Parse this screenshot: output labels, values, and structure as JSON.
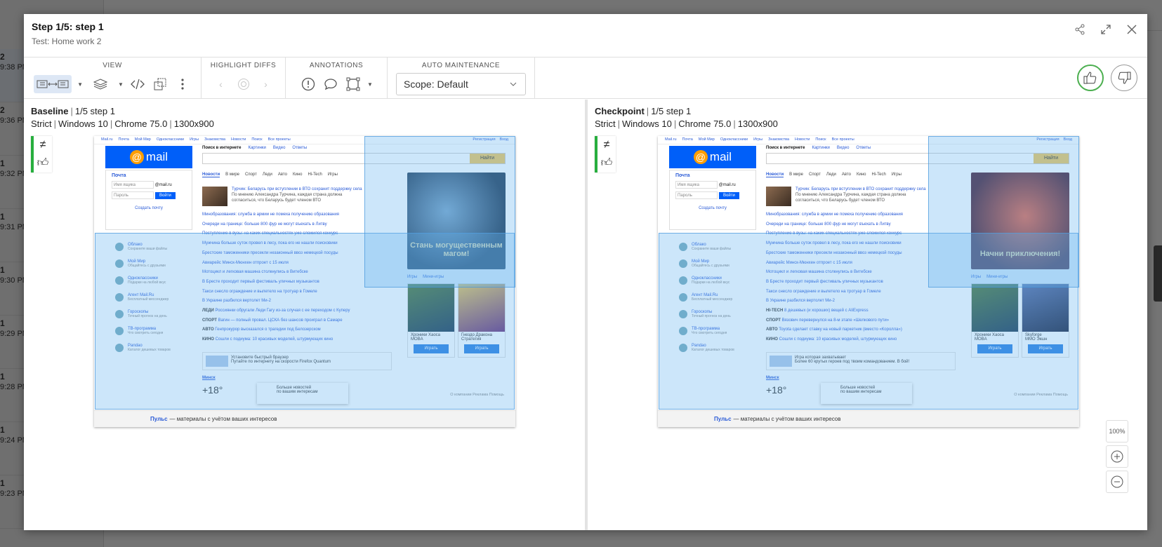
{
  "background": {
    "rows": [
      {
        "num": "2",
        "time": "9:38 PM",
        "selected": true
      },
      {
        "num": "2",
        "time": "9:36 PM"
      },
      {
        "num": "1",
        "time": "9:32 PM"
      },
      {
        "num": "1",
        "time": "9:31 PM"
      },
      {
        "num": "1",
        "time": "9:30 PM"
      },
      {
        "num": "1",
        "time": "9:29 PM"
      },
      {
        "num": "1",
        "time": "9:28 PM"
      },
      {
        "num": "1",
        "time": "9:24 PM"
      },
      {
        "num": "1",
        "time": "9:23 PM"
      }
    ]
  },
  "modal": {
    "title": "Step 1/5: step 1",
    "subtitle": "Test: Home work 2",
    "actions": [
      "share-icon",
      "expand-icon",
      "close-icon"
    ]
  },
  "toolbar": {
    "view_label": "VIEW",
    "highlight_label": "HIGHLIGHT DIFFS",
    "annotations_label": "ANNOTATIONS",
    "auto_label": "AUTO MAINTENANCE",
    "scope_value": "Scope: Default",
    "accent_color": "#4caf50"
  },
  "baseline": {
    "label": "Baseline",
    "step": "1/5 step 1",
    "match": "Strict",
    "os": "Windows 10",
    "browser": "Chrome 75.0",
    "size": "1300x900"
  },
  "checkpoint": {
    "label": "Checkpoint",
    "step": "1/5 step 1",
    "match": "Strict",
    "os": "Windows 10",
    "browser": "Chrome 75.0",
    "size": "1300x900"
  },
  "shot": {
    "topnav": [
      "Mail.ru",
      "Почта",
      "Мой Мир",
      "Одноклассники",
      "Игры",
      "Знакомства",
      "Новости",
      "Поиск",
      "Все проекты"
    ],
    "topnav_right": [
      "Регистрация",
      "Вход"
    ],
    "logo": "mail",
    "login_title": "Почта",
    "login_user": "Имя ящика",
    "login_domain": "@mail.ru",
    "login_pass": "Пароль",
    "login_button": "Войти",
    "login_create": "Создать почту",
    "search_tabs": [
      "Поиск в интернете",
      "Картинки",
      "Видео",
      "Ответы"
    ],
    "search_button": "Найти",
    "news_tabs": [
      "Новости",
      "В мире",
      "Спорт",
      "Леди",
      "Авто",
      "Кино",
      "Hi-Tech",
      "Игры"
    ],
    "news_first": "Турчин: Беларусь при вступлении в ВТО сохранит поддержку села",
    "news_first_desc": "По мнению Александра Турчина, каждая страна должна согласиться, что Беларусь будет членом ВТО",
    "news": [
      "Минобразования: служба в армии не помеха получению образования",
      "Очереди на границе: больше 800 фур не могут въехать в Литву",
      "Поступление в вузы: на каких специальностях уже сложился конкурс",
      "Мужчина больше суток провел в лесу, пока его не нашли поисковики",
      "Брестские таможенники пресекли незаконный ввоз немецкой посуды",
      "Авиарейс Минск-Мюнхен отпроет с 15 июля",
      "Мотоцикл и легковая машина столкнулись в Витебске",
      "В Бресте проходит первый фестиваль уличных музыкантов",
      "Такси снесло ограждение и вылетело на тротуар в Гомеле",
      "В Украине разбился вертолет Ми-2"
    ],
    "news_extra_base": [
      {
        "p": "ЛЕДИ",
        "t": "Россиянки обругали Леди Гагу из-за случая с ее переходом с Куперу"
      },
      {
        "p": "СПОРТ",
        "t": "Вагин — полный провал. ЦСКА без шансов проиграл в Самаре"
      },
      {
        "p": "АВТО",
        "t": "Генпрокурор высказался о трагедии под Белозерском"
      },
      {
        "p": "КИНО",
        "t": "Сошли с подиума: 10 красивых моделей, штурмующих кино"
      }
    ],
    "news_extra_check": [
      {
        "p": "HI-TECH",
        "t": "8 дешевых (и хороших) вещей с AliExpress"
      },
      {
        "p": "СПОРТ",
        "t": "Вязович перевернулся на 8-м этапе «Шелкового пути»"
      },
      {
        "p": "АВТО",
        "t": "Toyota сделает ставку на новый паркетник (вместо «Королла»)"
      },
      {
        "p": "КИНО",
        "t": "Сошли с подиума: 10 красивых моделей, штурмующих кино"
      }
    ],
    "services": [
      {
        "name": "Облако",
        "desc": "Сохраните ваши файлы"
      },
      {
        "name": "Мой Мир",
        "desc": "Общайтесь с друзьями"
      },
      {
        "name": "Одноклассники",
        "desc": "Подарки на любой вкус"
      },
      {
        "name": "Агент Mail.Ru",
        "desc": "Бесплатный мессенджер"
      },
      {
        "name": "Гороскопы",
        "desc": "Точный прогноз на день"
      },
      {
        "name": "ТВ-программа",
        "desc": "Что смотреть сегодня"
      },
      {
        "name": "Pandao",
        "desc": "Каталог дешевых товаров"
      }
    ],
    "promo_base": "Стань могущественным магом!",
    "promo_check": "Начни приключения!",
    "games_tabs": [
      "Игры",
      "Мини-игры"
    ],
    "games_base": [
      {
        "name": "Хроники Хаоса",
        "desc": "MOBA"
      },
      {
        "name": "Гнездо Дракона",
        "desc": "Стратегия"
      }
    ],
    "games_check": [
      {
        "name": "Хроники Хаоса",
        "desc": "MOBA"
      },
      {
        "name": "Skyforge",
        "desc": "MMO Экшн"
      }
    ],
    "game_button": "Играть",
    "fast_base": "Установите быстрый браузер",
    "fast_base_desc": "Путайте по интернету на скорости Firefox Quantum",
    "fast_check": "Игра которая захватывает",
    "fast_check_desc": "Более 60 крутых героев под твоим командованием. В бой!",
    "city": "Минск",
    "temp": "+18°",
    "more_news": "Больше новостей",
    "more_news_sub": "по вашим интересам",
    "footer_links": "О компании  Реклама  Помощь",
    "pulse_brand": "Пульс",
    "pulse_text": "— материалы с учётом ваших интересов"
  },
  "zoom": {
    "fit_label": "100%"
  }
}
